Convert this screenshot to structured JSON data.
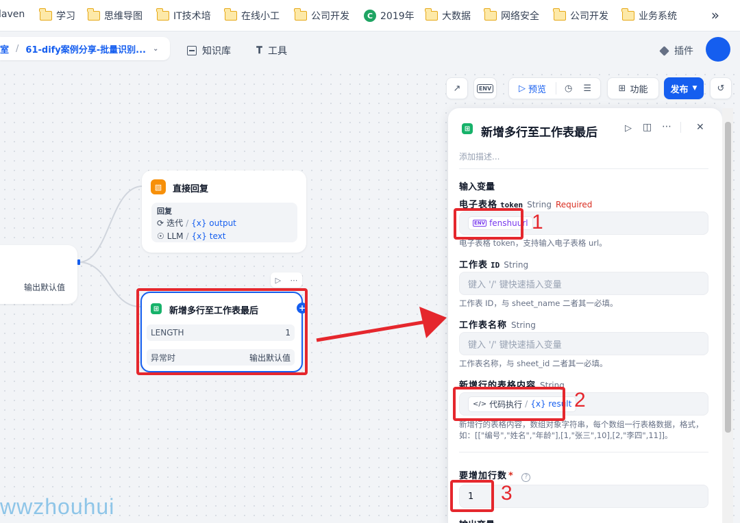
{
  "bookmarks": [
    "laven",
    "学习",
    "思维导图",
    "IT技术培",
    "在线小工",
    "公司开发",
    "2019年",
    "大数据",
    "网络安全",
    "公司开发",
    "业务系统"
  ],
  "bookmarks_more": "»",
  "header": {
    "workspace": "室",
    "app_name": "61-dify案例分享-批量识别...",
    "nav_knowledge": "知识库",
    "nav_tools": "工具",
    "plugins": "插件"
  },
  "toolbar": {
    "env": "ENV",
    "preview": "预览",
    "features": "功能",
    "publish": "发布"
  },
  "nodes": {
    "reply": {
      "title": "直接回复",
      "section": "回复",
      "var1_node": "迭代",
      "var1_name": "{x} output",
      "var2_node": "LLM",
      "var2_name": "{x} text"
    },
    "left_partial": {
      "value": "输出默认值"
    },
    "addrows": {
      "title": "新增多行至工作表最后",
      "row1_key": "LENGTH",
      "row1_val": "1",
      "row2_key": "异常时",
      "row2_val": "输出默认值"
    }
  },
  "panel": {
    "title": "新增多行至工作表最后",
    "desc_placeholder": "添加描述...",
    "section_input": "输入变量",
    "field1": {
      "label": "电子表格",
      "code": "token",
      "type": "String",
      "required": "Required",
      "chip_env": "ENV",
      "chip_var": "fenshuurl",
      "help": "电子表格 token，支持输入电子表格 url。"
    },
    "field2": {
      "label": "工作表",
      "code": "ID",
      "type": "String",
      "placeholder": "键入 '/' 键快速插入变量",
      "help": "工作表 ID，与 sheet_name 二者其一必填。"
    },
    "field3": {
      "label": "工作表名称",
      "type": "String",
      "placeholder": "键入 '/' 键快速插入变量",
      "help": "工作表名称，与 sheet_id 二者其一必填。"
    },
    "field4": {
      "label": "新增行的表格内容",
      "type": "String",
      "chip_node": "代码执行",
      "chip_var": "{x} result",
      "help1": "新增行的表格内容，数组对象字符串，每个数组一行表格数据，格式，",
      "help2": "如：[[\"编号\",\"姓名\",\"年龄\"],[1,\"张三\",10],[2,\"李四\",11]]。"
    },
    "field5": {
      "label": "要增加行数",
      "star": "*",
      "value": "1"
    },
    "section_output": "输出变量"
  },
  "annotations": [
    "1",
    "2",
    "3"
  ],
  "watermark": "wwzhouhui",
  "colors": {
    "accent": "#155eef",
    "annotation": "#e5272d",
    "node_green": "#17b26a",
    "node_orange": "#f79009"
  }
}
